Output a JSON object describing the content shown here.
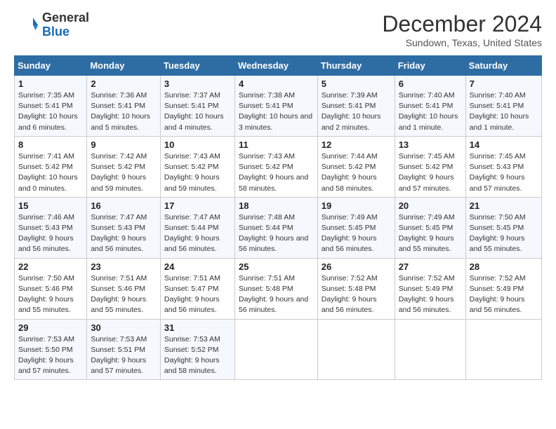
{
  "header": {
    "logo_general": "General",
    "logo_blue": "Blue",
    "month_title": "December 2024",
    "subtitle": "Sundown, Texas, United States"
  },
  "weekdays": [
    "Sunday",
    "Monday",
    "Tuesday",
    "Wednesday",
    "Thursday",
    "Friday",
    "Saturday"
  ],
  "weeks": [
    [
      {
        "day": 1,
        "sunrise": "7:35 AM",
        "sunset": "5:41 PM",
        "daylight": "10 hours and 6 minutes."
      },
      {
        "day": 2,
        "sunrise": "7:36 AM",
        "sunset": "5:41 PM",
        "daylight": "10 hours and 5 minutes."
      },
      {
        "day": 3,
        "sunrise": "7:37 AM",
        "sunset": "5:41 PM",
        "daylight": "10 hours and 4 minutes."
      },
      {
        "day": 4,
        "sunrise": "7:38 AM",
        "sunset": "5:41 PM",
        "daylight": "10 hours and 3 minutes."
      },
      {
        "day": 5,
        "sunrise": "7:39 AM",
        "sunset": "5:41 PM",
        "daylight": "10 hours and 2 minutes."
      },
      {
        "day": 6,
        "sunrise": "7:40 AM",
        "sunset": "5:41 PM",
        "daylight": "10 hours and 1 minute."
      },
      {
        "day": 7,
        "sunrise": "7:40 AM",
        "sunset": "5:41 PM",
        "daylight": "10 hours and 1 minute."
      }
    ],
    [
      {
        "day": 8,
        "sunrise": "7:41 AM",
        "sunset": "5:42 PM",
        "daylight": "10 hours and 0 minutes."
      },
      {
        "day": 9,
        "sunrise": "7:42 AM",
        "sunset": "5:42 PM",
        "daylight": "9 hours and 59 minutes."
      },
      {
        "day": 10,
        "sunrise": "7:43 AM",
        "sunset": "5:42 PM",
        "daylight": "9 hours and 59 minutes."
      },
      {
        "day": 11,
        "sunrise": "7:43 AM",
        "sunset": "5:42 PM",
        "daylight": "9 hours and 58 minutes."
      },
      {
        "day": 12,
        "sunrise": "7:44 AM",
        "sunset": "5:42 PM",
        "daylight": "9 hours and 58 minutes."
      },
      {
        "day": 13,
        "sunrise": "7:45 AM",
        "sunset": "5:42 PM",
        "daylight": "9 hours and 57 minutes."
      },
      {
        "day": 14,
        "sunrise": "7:45 AM",
        "sunset": "5:43 PM",
        "daylight": "9 hours and 57 minutes."
      }
    ],
    [
      {
        "day": 15,
        "sunrise": "7:46 AM",
        "sunset": "5:43 PM",
        "daylight": "9 hours and 56 minutes."
      },
      {
        "day": 16,
        "sunrise": "7:47 AM",
        "sunset": "5:43 PM",
        "daylight": "9 hours and 56 minutes."
      },
      {
        "day": 17,
        "sunrise": "7:47 AM",
        "sunset": "5:44 PM",
        "daylight": "9 hours and 56 minutes."
      },
      {
        "day": 18,
        "sunrise": "7:48 AM",
        "sunset": "5:44 PM",
        "daylight": "9 hours and 56 minutes."
      },
      {
        "day": 19,
        "sunrise": "7:49 AM",
        "sunset": "5:45 PM",
        "daylight": "9 hours and 56 minutes."
      },
      {
        "day": 20,
        "sunrise": "7:49 AM",
        "sunset": "5:45 PM",
        "daylight": "9 hours and 55 minutes."
      },
      {
        "day": 21,
        "sunrise": "7:50 AM",
        "sunset": "5:45 PM",
        "daylight": "9 hours and 55 minutes."
      }
    ],
    [
      {
        "day": 22,
        "sunrise": "7:50 AM",
        "sunset": "5:46 PM",
        "daylight": "9 hours and 55 minutes."
      },
      {
        "day": 23,
        "sunrise": "7:51 AM",
        "sunset": "5:46 PM",
        "daylight": "9 hours and 55 minutes."
      },
      {
        "day": 24,
        "sunrise": "7:51 AM",
        "sunset": "5:47 PM",
        "daylight": "9 hours and 56 minutes."
      },
      {
        "day": 25,
        "sunrise": "7:51 AM",
        "sunset": "5:48 PM",
        "daylight": "9 hours and 56 minutes."
      },
      {
        "day": 26,
        "sunrise": "7:52 AM",
        "sunset": "5:48 PM",
        "daylight": "9 hours and 56 minutes."
      },
      {
        "day": 27,
        "sunrise": "7:52 AM",
        "sunset": "5:49 PM",
        "daylight": "9 hours and 56 minutes."
      },
      {
        "day": 28,
        "sunrise": "7:52 AM",
        "sunset": "5:49 PM",
        "daylight": "9 hours and 56 minutes."
      }
    ],
    [
      {
        "day": 29,
        "sunrise": "7:53 AM",
        "sunset": "5:50 PM",
        "daylight": "9 hours and 57 minutes."
      },
      {
        "day": 30,
        "sunrise": "7:53 AM",
        "sunset": "5:51 PM",
        "daylight": "9 hours and 57 minutes."
      },
      {
        "day": 31,
        "sunrise": "7:53 AM",
        "sunset": "5:52 PM",
        "daylight": "9 hours and 58 minutes."
      },
      null,
      null,
      null,
      null
    ]
  ]
}
